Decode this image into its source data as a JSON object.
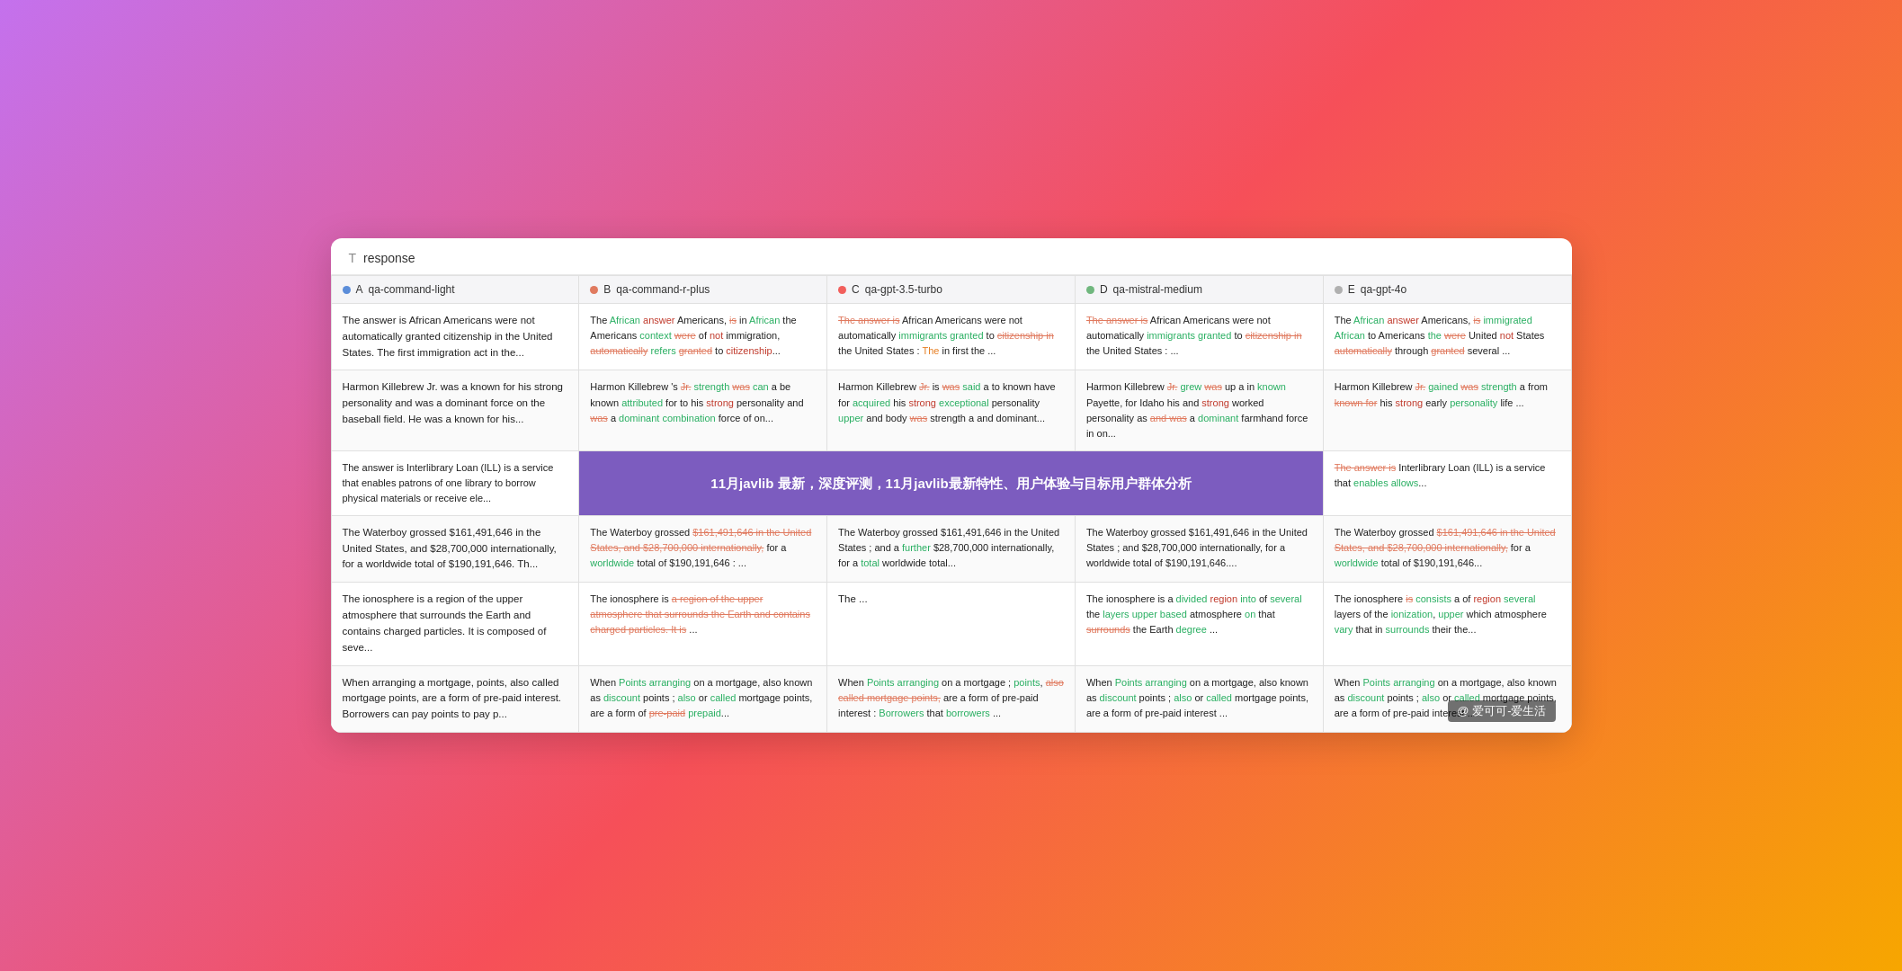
{
  "header": {
    "icon": "T",
    "title": "response"
  },
  "columns": [
    {
      "id": "A",
      "dot": "dot-a",
      "label": "qa-command-light"
    },
    {
      "id": "B",
      "dot": "dot-b",
      "label": "qa-command-r-plus"
    },
    {
      "id": "C",
      "dot": "dot-c",
      "label": "qa-gpt-3.5-turbo"
    },
    {
      "id": "D",
      "dot": "dot-d",
      "label": "qa-mistral-medium"
    },
    {
      "id": "E",
      "dot": "dot-e",
      "label": "qa-gpt-4o"
    }
  ],
  "banner": "11月javlib 最新，深度评测，11月javlib最新特性、用户体验与目标用户群体分析",
  "watermark": "@ 爱可可-爱生活"
}
